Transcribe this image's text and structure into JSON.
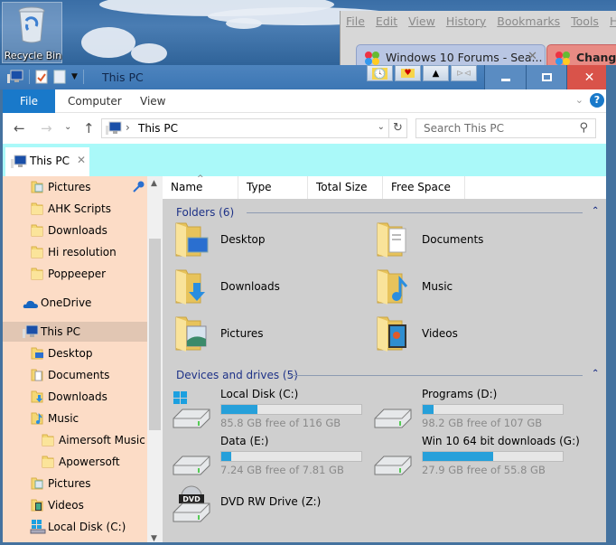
{
  "desktop": {
    "recycle_bin_label": "Recycle Bin"
  },
  "firefox": {
    "menu": [
      "File",
      "Edit",
      "View",
      "History",
      "Bookmarks",
      "Tools",
      "Help"
    ],
    "tabs": [
      {
        "label": "Windows 10 Forums - Sea...",
        "active": true
      },
      {
        "label": "Changin",
        "active": false
      }
    ]
  },
  "explorer": {
    "title": "This PC",
    "quick_access_icons": [
      "properties-icon",
      "new-folder-icon",
      "customize-dropdown-icon"
    ],
    "extra_title_buttons": [
      "recent-folder-clock-icon",
      "favorite-folder-heart-icon",
      "up-triangle-icon",
      "pin-icon"
    ],
    "caption_buttons": {
      "minimize": "minimize",
      "maximize": "maximize",
      "close": "close"
    },
    "ribbon": {
      "tabs": [
        "File",
        "Computer",
        "View"
      ],
      "help": "?"
    },
    "nav": {
      "back": "←",
      "forward": "→",
      "recent": "⌄",
      "up": "↑",
      "address_separator": "›",
      "address": "This PC",
      "search_placeholder": "Search This PC"
    },
    "tab": {
      "label": "This PC",
      "close": "✕"
    },
    "sidebar": {
      "items": [
        {
          "label": "Pictures",
          "indent": 2,
          "icon": "pictures-folder-icon",
          "pinned": true
        },
        {
          "label": "AHK Scripts",
          "indent": 2,
          "icon": "folder-icon"
        },
        {
          "label": "Downloads",
          "indent": 2,
          "icon": "folder-icon"
        },
        {
          "label": "Hi resolution",
          "indent": 2,
          "icon": "folder-icon"
        },
        {
          "label": "Poppeeper",
          "indent": 2,
          "icon": "folder-icon"
        },
        {
          "label": "OneDrive",
          "indent": 1,
          "icon": "onedrive-icon"
        },
        {
          "label": "This PC",
          "indent": 1,
          "icon": "this-pc-icon",
          "selected": true
        },
        {
          "label": "Desktop",
          "indent": 2,
          "icon": "desktop-folder-icon"
        },
        {
          "label": "Documents",
          "indent": 2,
          "icon": "documents-folder-icon"
        },
        {
          "label": "Downloads",
          "indent": 2,
          "icon": "downloads-folder-icon"
        },
        {
          "label": "Music",
          "indent": 2,
          "icon": "music-folder-icon"
        },
        {
          "label": "Aimersoft Music R",
          "indent": 3,
          "icon": "folder-icon"
        },
        {
          "label": "Apowersoft",
          "indent": 3,
          "icon": "folder-icon"
        },
        {
          "label": "Pictures",
          "indent": 2,
          "icon": "pictures-folder-icon"
        },
        {
          "label": "Videos",
          "indent": 2,
          "icon": "videos-folder-icon"
        },
        {
          "label": "Local Disk (C:)",
          "indent": 2,
          "icon": "windows-drive-icon"
        }
      ]
    },
    "columns": [
      "Name",
      "Type",
      "Total Size",
      "Free Space"
    ],
    "folders_group": {
      "label": "Folders (6)",
      "items": [
        {
          "label": "Desktop",
          "icon": "desktop-folder-icon"
        },
        {
          "label": "Documents",
          "icon": "documents-folder-icon"
        },
        {
          "label": "Downloads",
          "icon": "downloads-folder-icon"
        },
        {
          "label": "Music",
          "icon": "music-folder-icon"
        },
        {
          "label": "Pictures",
          "icon": "pictures-folder-icon"
        },
        {
          "label": "Videos",
          "icon": "videos-folder-icon"
        }
      ]
    },
    "drives_group": {
      "label": "Devices and drives (5)",
      "items": [
        {
          "label": "Local Disk (C:)",
          "free_text": "85.8 GB free of 116 GB",
          "used_percent": 26,
          "icon": "windows-drive-icon"
        },
        {
          "label": "Programs (D:)",
          "free_text": "98.2 GB free of 107 GB",
          "used_percent": 8,
          "icon": "hard-drive-icon"
        },
        {
          "label": "Data (E:)",
          "free_text": "7.24 GB free of 7.81 GB",
          "used_percent": 7,
          "icon": "hard-drive-icon"
        },
        {
          "label": "Win 10 64 bit downloads (G:)",
          "free_text": "27.9 GB free of 55.8 GB",
          "used_percent": 50,
          "icon": "hard-drive-icon"
        },
        {
          "label": "DVD RW Drive (Z:)",
          "icon": "dvd-drive-icon"
        }
      ]
    },
    "colors": {
      "accent": "#1979ca",
      "bar_fill": "#26a0da",
      "group_header": "#1e3287",
      "sidebar_bg": "#fcdcc6",
      "tabbar_bg": "#aaf9f9",
      "content_bg": "#cfcfcf",
      "close_red": "#d9534a"
    }
  }
}
